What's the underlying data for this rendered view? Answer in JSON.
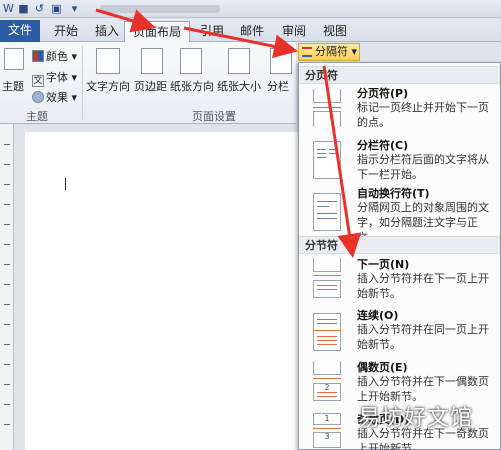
{
  "tabs": [
    {
      "label": "文件"
    },
    {
      "label": "开始"
    },
    {
      "label": "插入"
    },
    {
      "label": "页面布局"
    },
    {
      "label": "引用"
    },
    {
      "label": "邮件"
    },
    {
      "label": "审阅"
    },
    {
      "label": "视图"
    }
  ],
  "ribbon": {
    "theme_group": {
      "label": "主题",
      "theme_btn": "主题",
      "colors": "颜色",
      "fonts": "字体",
      "effects": "效果"
    },
    "page_setup": {
      "label": "页面设置",
      "text_direction": "文字方向",
      "margins": "页边距",
      "orientation": "纸张方向",
      "size": "纸张大小",
      "columns": "分栏"
    }
  },
  "breaks_button": {
    "label": "分隔符"
  },
  "menu": {
    "page_breaks_header": "分页符",
    "section_breaks_header": "分节符",
    "items": [
      {
        "title": "分页符(P)",
        "desc": "标记一页终止并开始下一页的点。"
      },
      {
        "title": "分栏符(C)",
        "desc": "指示分栏符后面的文字将从下一栏开始。"
      },
      {
        "title": "自动换行符(T)",
        "desc": "分隔网页上的对象周围的文字，如分隔题注文字与正文。"
      },
      {
        "title": "下一页(N)",
        "desc": "插入分节符并在下一页上开始新节。"
      },
      {
        "title": "连续(O)",
        "desc": "插入分节符并在同一页上开始新节。"
      },
      {
        "title": "偶数页(E)",
        "desc": "插入分节符并在下一偶数页上开始新节。"
      },
      {
        "title": "奇数页(D)",
        "desc": "插入分节符并在下一奇数页上开始新节。"
      }
    ]
  },
  "watermark": "易坊好文馆",
  "colors": {
    "file_tab": "#2c5ca6",
    "arrow": "#e8312a",
    "breaks_highlight": "#ffcf5e"
  }
}
